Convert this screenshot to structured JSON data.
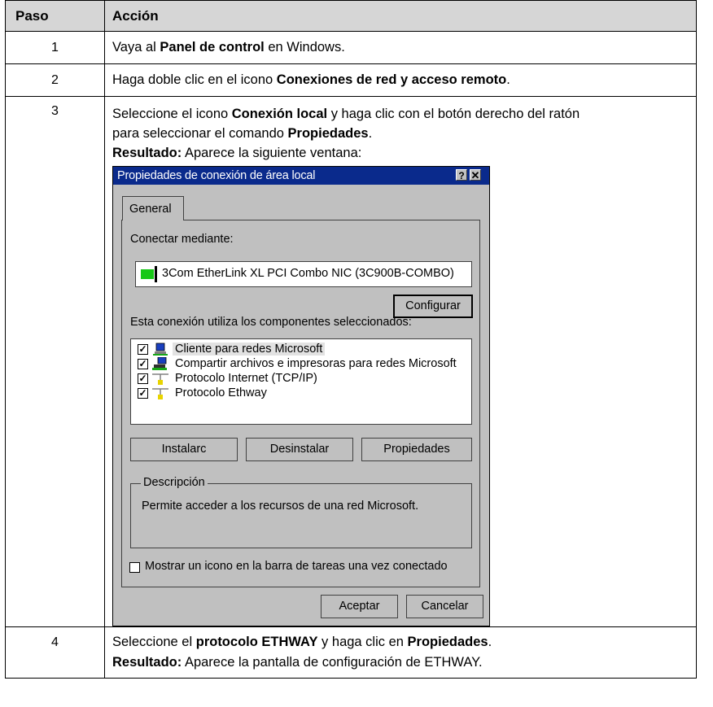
{
  "table": {
    "headers": {
      "step": "Paso",
      "action": "Acción"
    },
    "rows": [
      {
        "step": "1",
        "parts": [
          "Vaya al ",
          "Panel de control",
          " en Windows."
        ]
      },
      {
        "step": "2",
        "parts": [
          "Haga doble clic en el icono ",
          "Conexiones de red y acceso remoto",
          "."
        ]
      },
      {
        "step": "3",
        "line1": [
          "Seleccione el icono ",
          "Conexión local",
          " y haga clic con el botón derecho del ratón"
        ],
        "line2": [
          "para seleccionar el comando ",
          "Propiedades",
          "."
        ],
        "result_label": "Resultado:",
        "result_text": " Aparece la siguiente ventana:"
      },
      {
        "step": "4",
        "line1": [
          "Seleccione el ",
          "protocolo ETHWAY",
          " y haga clic en ",
          "Propiedades",
          "."
        ],
        "result_label": "Resultado:",
        "result_text": " Aparece la pantalla de configuración de ETHWAY."
      }
    ]
  },
  "dialog": {
    "title": "Propiedades de conexión de área local",
    "help_glyph": "?",
    "close_glyph": "✕",
    "tab": "General",
    "connect_using_label": "Conectar mediante:",
    "adapter": "3Com EtherLink XL PCI Combo NIC (3C900B-COMBO)",
    "configure_button": "Configurar",
    "components_label": "Esta conexión utiliza los componentes seleccionados:",
    "components": [
      {
        "label": "Cliente para redes Microsoft",
        "checked": true,
        "icon": "network-client-icon",
        "selected": true
      },
      {
        "label": "Compartir archivos e impresoras para redes Microsoft",
        "checked": true,
        "icon": "file-printer-sharing-icon",
        "selected": false
      },
      {
        "label": "Protocolo Internet (TCP/IP)",
        "checked": true,
        "icon": "protocol-icon",
        "selected": false
      },
      {
        "label": "Protocolo Ethway",
        "checked": true,
        "icon": "protocol-icon",
        "selected": false
      }
    ],
    "install_button": "Instalarc",
    "uninstall_button": "Desinstalar",
    "properties_button": "Propiedades",
    "description_legend": "Descripción",
    "description_text": "Permite acceder a los recursos de una red Microsoft.",
    "show_icon_label": "Mostrar un icono en la barra de tareas una vez conectado",
    "show_icon_checked": false,
    "ok_button": "Aceptar",
    "cancel_button": "Cancelar"
  }
}
